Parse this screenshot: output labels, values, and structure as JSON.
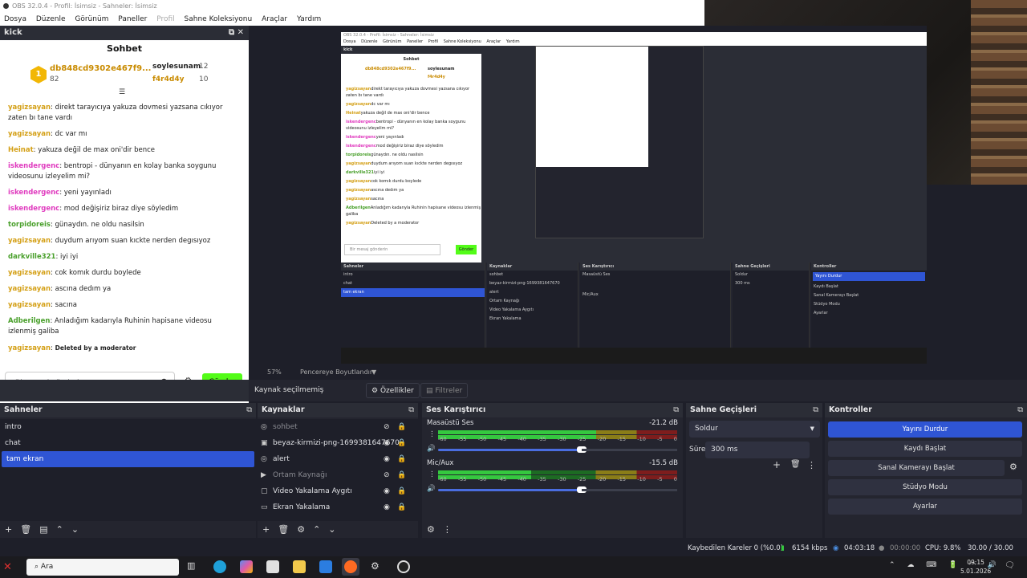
{
  "window": {
    "title": "OBS 32.0.4 - Profil: İsimsiz - Sahneler: İsimsiz",
    "menu": [
      "Dosya",
      "Düzenle",
      "Görünüm",
      "Paneller",
      "Profil",
      "Sahne Koleksiyonu",
      "Araçlar",
      "Yardım"
    ]
  },
  "chat_dock": {
    "dock_title": "kick",
    "title": "Sohbet",
    "leaderboard": {
      "first": {
        "rank": "1",
        "name": "db848cd9302e467f9...",
        "value": "82"
      },
      "second": {
        "name": "soylesunam",
        "value": "12"
      },
      "third": {
        "name": "f4r4d4y",
        "value": "10"
      }
    },
    "messages": [
      {
        "user": "yagizsayan",
        "text": "direkt tarayıcıya yakuza dovmesi yazsana cıkıyor zaten bı tane vardı",
        "color": "#d4a017"
      },
      {
        "user": "yagizsayan",
        "text": "dc var mı",
        "color": "#d4a017"
      },
      {
        "user": "Heinat",
        "text": "yakuza değil de max oni'dir bence",
        "color": "#d4a017"
      },
      {
        "user": "iskendergenc",
        "text": "bentropi - dünyanın en kolay banka soygunu videosunu izleyelim mi?",
        "color": "#e03cbf"
      },
      {
        "user": "iskendergenc",
        "text": "yeni yayınladı",
        "color": "#e03cbf"
      },
      {
        "user": "iskendergenc",
        "text": "mod değişiriz biraz diye söyledim",
        "color": "#e03cbf"
      },
      {
        "user": "torpidoreis",
        "text": "günaydın. ne oldu nasilsin",
        "color": "#4aa02c"
      },
      {
        "user": "yagizsayan",
        "text": "duydum arıyom suan kıckte nerden degısıyoz",
        "color": "#d4a017"
      },
      {
        "user": "darkville321",
        "text": "iyi iyi",
        "color": "#4aa02c"
      },
      {
        "user": "yagizsayan",
        "text": "cok komık durdu boylede",
        "color": "#d4a017"
      },
      {
        "user": "yagizsayan",
        "text": "ascına dedım ya",
        "color": "#d4a017"
      },
      {
        "user": "yagizsayan",
        "text": "sacına",
        "color": "#d4a017"
      },
      {
        "user": "Adberilgen",
        "text": "Anladığım kadarıyla Ruhinin hapisane videosu izlenmiş galiba",
        "color": "#4aa02c"
      },
      {
        "user": "yagizsayan",
        "text": "Deleted by a moderator",
        "color": "#d4a017"
      }
    ],
    "input_placeholder": "Bir mesaj gönderin",
    "send_label": "Gönder"
  },
  "preview_toolbar": {
    "zoom": "57%",
    "fit_label": "Pencereye Boyutlandır"
  },
  "context_bar": {
    "no_source": "Kaynak seçilmemiş",
    "properties": "Özellikler",
    "filters": "Filtreler"
  },
  "scenes": {
    "title": "Sahneler",
    "items": [
      {
        "label": "intro"
      },
      {
        "label": "chat"
      },
      {
        "label": "tam ekran"
      }
    ]
  },
  "sources": {
    "title": "Kaynaklar",
    "items": [
      {
        "label": "sohbet"
      },
      {
        "label": "beyaz-kirmizi-png-1699381647670"
      },
      {
        "label": "alert"
      },
      {
        "label": "Ortam Kaynağı"
      },
      {
        "label": "Video Yakalama Aygıtı"
      },
      {
        "label": "Ekran Yakalama"
      }
    ]
  },
  "mixer": {
    "title": "Ses Karıştırıcı",
    "ticks": [
      "-60",
      "-55",
      "-50",
      "-45",
      "-40",
      "-35",
      "-30",
      "-25",
      "-20",
      "-15",
      "-10",
      "-5",
      "0"
    ],
    "channels": [
      {
        "name": "Masaüstü Ses",
        "db": "-21.2 dB",
        "level": 0.66,
        "volume": 0.6
      },
      {
        "name": "Mic/Aux",
        "db": "-15.5 dB",
        "level": 0.39,
        "volume": 0.6
      }
    ]
  },
  "transitions": {
    "title": "Sahne Geçişleri",
    "selected": "Soldur",
    "duration_label": "Süre",
    "duration": "300 ms"
  },
  "controls": {
    "title": "Kontroller",
    "buttons": [
      "Yayını Durdur",
      "Kaydı Başlat",
      "Sanal Kamerayı Başlat",
      "Stüdyo Modu",
      "Ayarlar"
    ]
  },
  "status": {
    "dropped": "Kaybedilen Kareler 0 (%0.0)",
    "bitrate": "6154 kbps",
    "stream_time": "04:03:18",
    "rec_time": "00:00:00",
    "cpu": "CPU: 9.8%",
    "fps": "30.00 / 30.00 FPS"
  },
  "taskbar": {
    "search_text": "Ara",
    "time": "09:15",
    "date": "5.01.2026"
  },
  "colors": {
    "accent": "#2f55d4",
    "kick_green": "#53fc18",
    "panel_bg": "#24252f",
    "header_bg": "#2b2d36"
  }
}
